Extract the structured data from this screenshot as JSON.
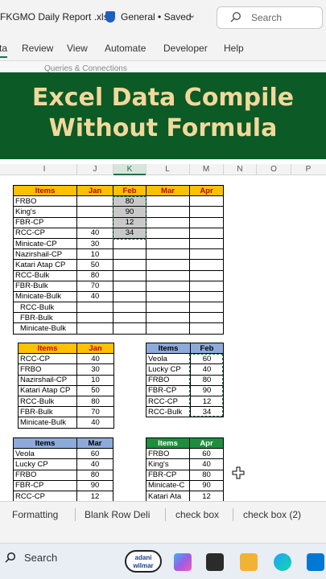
{
  "titlebar": {
    "filename": "FKGMO Daily Report .xlsx",
    "sensitivity": "General",
    "status": "• Saved",
    "search_placeholder": "Search"
  },
  "ribbon": {
    "tabs": [
      "ta",
      "Review",
      "View",
      "Automate",
      "Developer",
      "Help"
    ],
    "active_tab": "ta",
    "hint": "Queries & Connections"
  },
  "banner": {
    "line1": "Excel Data Compile",
    "line2": "Without Formula"
  },
  "columns": [
    "I",
    "J",
    "K",
    "L",
    "M",
    "N",
    "O",
    "P"
  ],
  "selected_column": "K",
  "table_main": {
    "headers": [
      "Items",
      "Jan",
      "Feb",
      "Mar",
      "Apr"
    ],
    "rows": [
      [
        "FRBO",
        "",
        "80",
        "",
        ""
      ],
      [
        "King's",
        "",
        "90",
        "",
        ""
      ],
      [
        "FBR-CP",
        "",
        "12",
        "",
        ""
      ],
      [
        "RCC-CP",
        "40",
        "34",
        "",
        ""
      ],
      [
        "Minicate-CP",
        "30",
        "",
        "",
        ""
      ],
      [
        "Nazirshail-CP",
        "10",
        "",
        "",
        ""
      ],
      [
        "Katari Atap CP",
        "50",
        "",
        "",
        ""
      ],
      [
        "RCC-Bulk",
        "80",
        "",
        "",
        ""
      ],
      [
        "FBR-Bulk",
        "70",
        "",
        "",
        ""
      ],
      [
        "Minicate-Bulk",
        "40",
        "",
        "",
        ""
      ],
      [
        "RCC-Bulk",
        "",
        "",
        "",
        ""
      ],
      [
        "FBR-Bulk",
        "",
        "",
        "",
        ""
      ],
      [
        "Minicate-Bulk",
        "",
        "",
        "",
        ""
      ]
    ]
  },
  "table_jan": {
    "headers": [
      "Items",
      "Jan"
    ],
    "rows": [
      [
        "RCC-CP",
        "40"
      ],
      [
        "FRBO",
        "30"
      ],
      [
        "Nazirshail-CP",
        "10"
      ],
      [
        "Katari Atap CP",
        "50"
      ],
      [
        "RCC-Bulk",
        "80"
      ],
      [
        "FBR-Bulk",
        "70"
      ],
      [
        "Minicate-Bulk",
        "40"
      ]
    ]
  },
  "table_feb": {
    "headers": [
      "Items",
      "Feb"
    ],
    "rows": [
      [
        "Veola",
        "60"
      ],
      [
        "Lucky CP",
        "40"
      ],
      [
        "FRBO",
        "80"
      ],
      [
        "FBR-CP",
        "90"
      ],
      [
        "RCC-CP",
        "12"
      ],
      [
        "RCC-Bulk",
        "34"
      ]
    ]
  },
  "table_mar": {
    "headers": [
      "Items",
      "Mar"
    ],
    "rows": [
      [
        "Veola",
        "60"
      ],
      [
        "Lucky CP",
        "40"
      ],
      [
        "FRBO",
        "80"
      ],
      [
        "FBR-CP",
        "90"
      ],
      [
        "RCC-CP",
        "12"
      ]
    ]
  },
  "table_apr": {
    "headers": [
      "Items",
      "Apr"
    ],
    "rows": [
      [
        "FRBO",
        "60"
      ],
      [
        "King's",
        "40"
      ],
      [
        "FBR-CP",
        "80"
      ],
      [
        "Minicate-C",
        "90"
      ],
      [
        "Katari Ata",
        "12"
      ]
    ]
  },
  "sheet_tabs": [
    "Formatting",
    "Blank Row Deli",
    "check box",
    "check box (2)"
  ],
  "taskbar": {
    "search_label": "Search",
    "badge": "adani wilmar"
  },
  "colors": {
    "banner_bg": "#0c5a25",
    "banner_text": "#f2d89b",
    "header_yellow": "#ffc000",
    "header_blue": "#8eaadb",
    "header_green": "#1e8e3e"
  }
}
